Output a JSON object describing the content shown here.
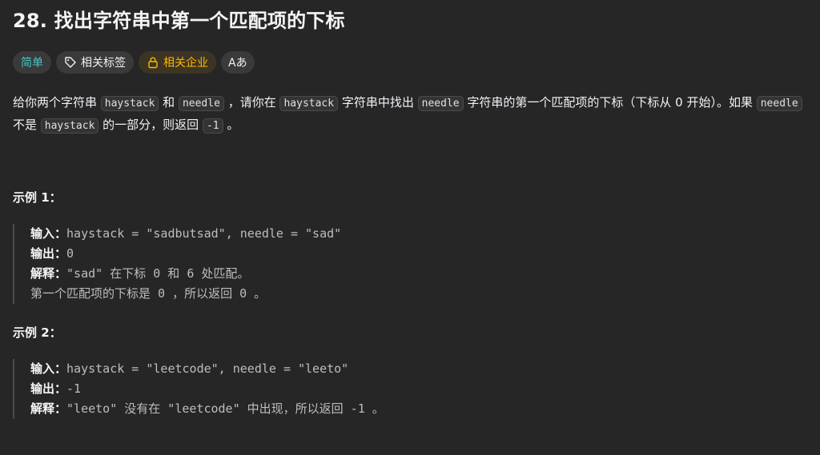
{
  "problem": {
    "title": "28. 找出字符串中第一个匹配项的下标"
  },
  "tags": {
    "difficulty": "简单",
    "topics": "相关标签",
    "companies": "相关企业",
    "font_toggle": "Aあ"
  },
  "description": {
    "p1": "给你两个字符串 ",
    "haystack1": "haystack",
    "p2": " 和 ",
    "needle1": "needle",
    "p3": " ，请你在 ",
    "haystack2": "haystack",
    "p4": " 字符串中找出 ",
    "needle2": "needle",
    "p5": " 字符串的第一个匹配项的下标（下标从 0 开始）。如果 ",
    "needle3": "needle",
    "p6": " 不是 ",
    "haystack3": "haystack",
    "p7": " 的一部分，则返回 ",
    "minus_one": "-1",
    "p8": " 。"
  },
  "examples": [
    {
      "title": "示例 1：",
      "input_label": "输入：",
      "input": "haystack = \"sadbutsad\", needle = \"sad\"",
      "output_label": "输出：",
      "output": "0",
      "explain_label": "解释：",
      "explain": "\"sad\" 在下标 0 和 6 处匹配。",
      "explain2": "第一个匹配项的下标是 0 ，所以返回 0 。"
    },
    {
      "title": "示例 2：",
      "input_label": "输入：",
      "input": "haystack = \"leetcode\", needle = \"leeto\"",
      "output_label": "输出：",
      "output": "-1",
      "explain_label": "解释：",
      "explain": "\"leeto\" 没有在 \"leetcode\" 中出现，所以返回 -1 。"
    }
  ],
  "colors": {
    "background": "#262626",
    "easy": "#46c6c2",
    "company": "#ffb800"
  }
}
